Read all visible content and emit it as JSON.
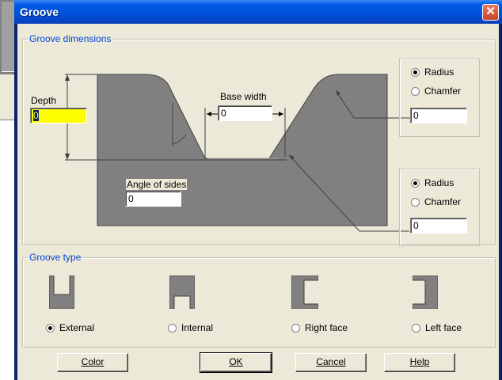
{
  "dialog": {
    "title": "Groove"
  },
  "dimensions": {
    "group_label": "Groove dimensions",
    "depth": {
      "label": "Depth",
      "value": "0"
    },
    "base_width": {
      "label": "Base width",
      "value": "0"
    },
    "angle": {
      "label": "Angle of sides",
      "value": "0"
    },
    "top_corner": {
      "radius_label": "Radius",
      "chamfer_label": "Chamfer",
      "selected": "Radius",
      "value": "0"
    },
    "bottom_corner": {
      "radius_label": "Radius",
      "chamfer_label": "Chamfer",
      "selected": "Radius",
      "value": "0"
    }
  },
  "groove_type": {
    "group_label": "Groove type",
    "options": [
      {
        "label": "External",
        "selected": true,
        "icon": "external-groove-icon"
      },
      {
        "label": "Internal",
        "selected": false,
        "icon": "internal-groove-icon"
      },
      {
        "label": "Right face",
        "selected": false,
        "icon": "right-face-groove-icon"
      },
      {
        "label": "Left face",
        "selected": false,
        "icon": "left-face-groove-icon"
      }
    ]
  },
  "buttons": {
    "color": "Color",
    "ok": "OK",
    "cancel": "Cancel",
    "help": "Help"
  },
  "colors": {
    "shape": "#808080",
    "depth_highlight": "#ffff00",
    "group_label": "#0046d5",
    "titlebar": "#0054e3"
  }
}
